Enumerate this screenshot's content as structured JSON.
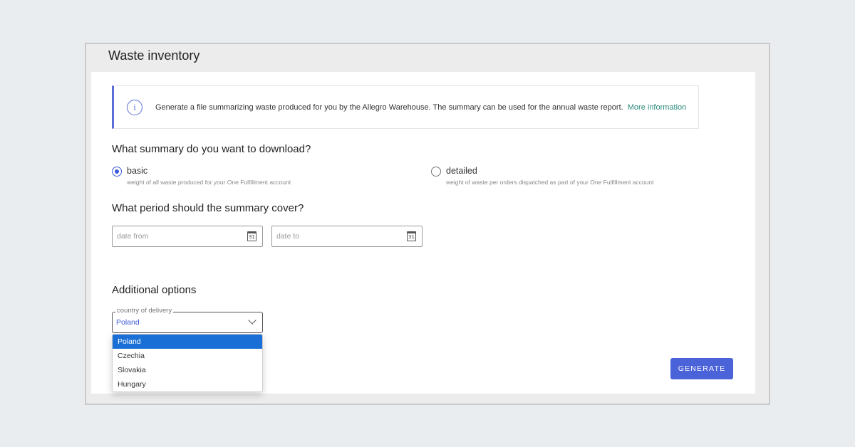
{
  "page": {
    "title": "Waste inventory"
  },
  "info": {
    "text": "Generate a file summarizing waste produced for you by the Allegro Warehouse. The summary can be used for the annual waste report.",
    "link": "More information",
    "icon": "info-icon"
  },
  "summary": {
    "heading": "What summary do you want to download?",
    "options": [
      {
        "label": "basic",
        "description": "weight of all waste produced for your One Fulfillment account",
        "selected": true
      },
      {
        "label": "detailed",
        "description": "weight of waste per orders dispatched as part of your One Fulfillment account",
        "selected": false
      }
    ]
  },
  "period": {
    "heading": "What period should the summary cover?",
    "date_from_placeholder": "date from",
    "date_to_placeholder": "date to",
    "calendar_icon_text": "31"
  },
  "additional": {
    "heading": "Additional options",
    "country_label": "country of delivery",
    "country_value": "Poland",
    "country_options": [
      "Poland",
      "Czechia",
      "Slovakia",
      "Hungary"
    ]
  },
  "actions": {
    "generate_label": "GENERATE"
  },
  "colors": {
    "accent": "#4a63d9",
    "link": "#2a8a7a",
    "selected_option": "#1a6fd6"
  }
}
